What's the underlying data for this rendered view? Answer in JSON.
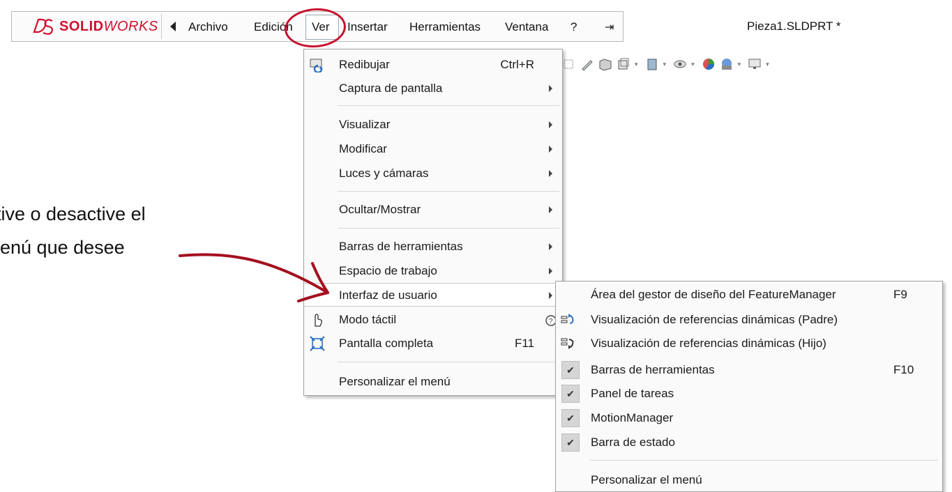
{
  "app": {
    "brand_bold": "SOLID",
    "brand_italic": "WORKS",
    "document_title": "Pieza1.SLDPRT *"
  },
  "menubar": {
    "items": [
      "Archivo",
      "Edición",
      "Ver",
      "Insertar",
      "Herramientas",
      "Ventana",
      "?"
    ]
  },
  "toolbar": {
    "icons": [
      "section-view-icon",
      "edit-appearance-icon",
      "view-orientation-icon",
      "display-style-icon",
      "hide-show-icon",
      "apply-scene-icon",
      "view-settings-icon",
      "display-icon"
    ]
  },
  "ver_menu": {
    "items": [
      {
        "label": "Redibujar",
        "shortcut": "Ctrl+R",
        "icon": "redraw-icon"
      },
      {
        "label": "Captura de pantalla",
        "submenu": true
      },
      {
        "label": "Visualizar",
        "submenu": true
      },
      {
        "label": "Modificar",
        "submenu": true
      },
      {
        "label": "Luces y cámaras",
        "submenu": true
      },
      {
        "label": "Ocultar/Mostrar",
        "submenu": true
      },
      {
        "label": "Barras de herramientas",
        "submenu": true
      },
      {
        "label": "Espacio de trabajo",
        "submenu": true
      },
      {
        "label": "Interfaz de usuario",
        "submenu": true,
        "highlighted": true
      },
      {
        "label": "Modo táctil",
        "icon": "touch-mode-icon",
        "right_icon": "help-icon"
      },
      {
        "label": "Pantalla completa",
        "shortcut": "F11",
        "icon": "full-screen-icon"
      },
      {
        "label": "Personalizar el menú"
      }
    ]
  },
  "sub_menu": {
    "items": [
      {
        "label": "Área del gestor de diseño del FeatureManager",
        "shortcut": "F9"
      },
      {
        "label": "Visualización de referencias dinámicas (Padre)",
        "icon": "dynamic-reference-parent-icon"
      },
      {
        "label": "Visualización de referencias dinámicas (Hijo)",
        "icon": "dynamic-reference-child-icon"
      },
      {
        "label": "Barras de herramientas",
        "shortcut": "F10",
        "checked": true
      },
      {
        "label": "Panel de tareas",
        "checked": true
      },
      {
        "label": "MotionManager",
        "checked": true
      },
      {
        "label": "Barra de estado",
        "checked": true
      },
      {
        "label": "Personalizar el menú"
      }
    ]
  },
  "annotation": {
    "line1": "tive o desactive el",
    "line2": "enú que desee"
  },
  "colors": {
    "accent_red": "#c8102e",
    "brand_red": "#d0102e",
    "icon_blue": "#2a6fc0"
  }
}
